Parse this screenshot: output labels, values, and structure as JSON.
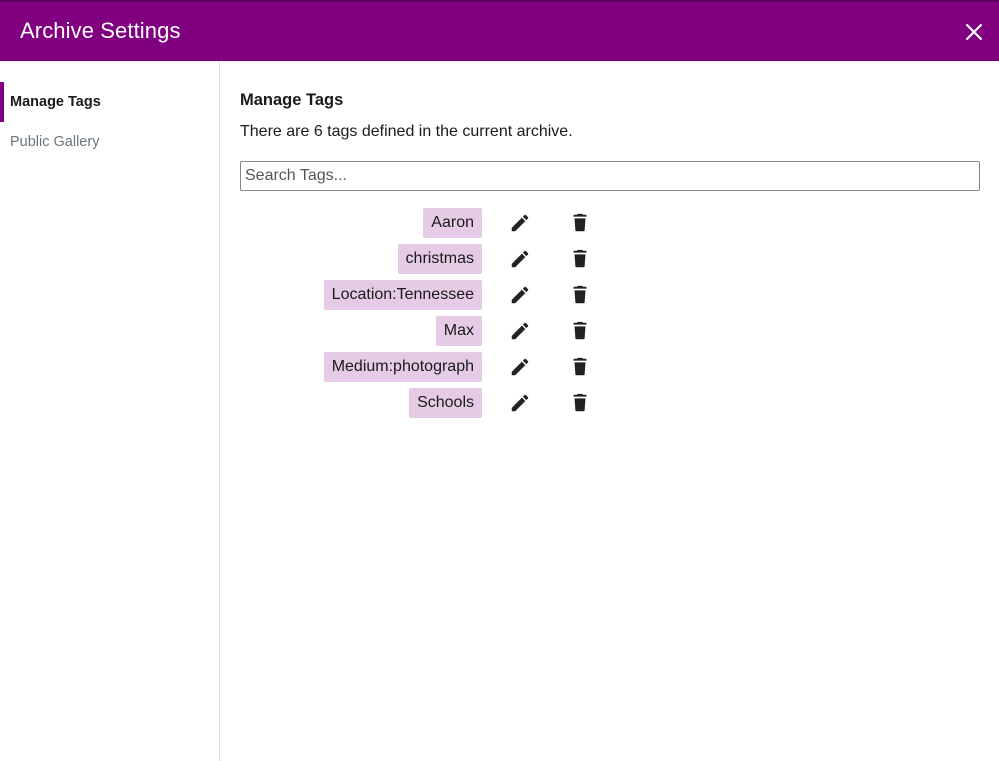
{
  "header": {
    "title": "Archive Settings",
    "close_icon": "close-icon",
    "bg_color": "#800080"
  },
  "sidebar": {
    "items": [
      {
        "label": "Manage Tags",
        "active": true
      },
      {
        "label": "Public Gallery",
        "active": false
      }
    ]
  },
  "main": {
    "title": "Manage Tags",
    "count_text": "There are 6 tags defined in the current archive.",
    "search": {
      "placeholder": "Search Tags...",
      "value": ""
    },
    "tags": [
      {
        "label": "Aaron"
      },
      {
        "label": "christmas"
      },
      {
        "label": "Location:Tennessee"
      },
      {
        "label": "Max"
      },
      {
        "label": "Medium:photograph"
      },
      {
        "label": "Schools"
      }
    ],
    "edit_icon": "pencil-icon",
    "delete_icon": "trash-icon",
    "tag_color": "#e5cbe5"
  }
}
